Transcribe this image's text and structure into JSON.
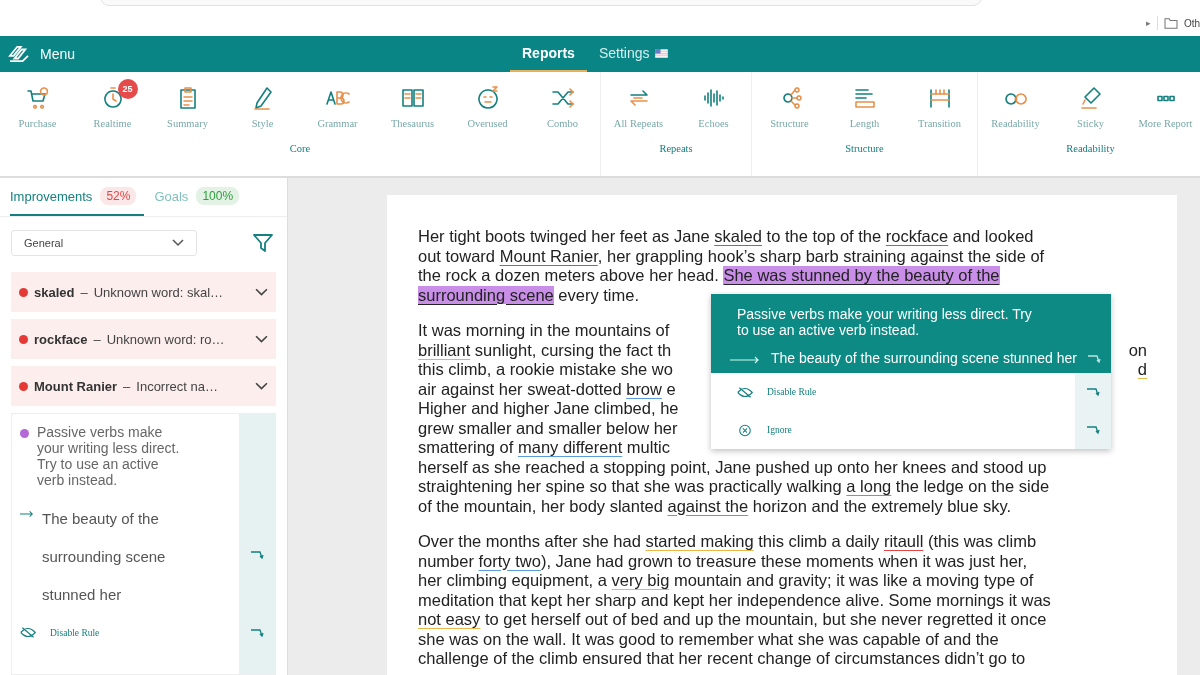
{
  "browser": {
    "arrow": "▸",
    "bookmark": "Oth"
  },
  "header": {
    "menu": "Menu",
    "nav": [
      {
        "label": "Reports",
        "selected": true,
        "flag": false
      },
      {
        "label": "Settings",
        "selected": false,
        "flag": true
      }
    ]
  },
  "ribbon": [
    {
      "label": "Core",
      "items": [
        {
          "label": "Purchase"
        },
        {
          "label": "Realtime",
          "badge": "25"
        },
        {
          "label": "Summary"
        },
        {
          "label": "Style"
        },
        {
          "label": "Grammar"
        },
        {
          "label": "Thesaurus"
        },
        {
          "label": "Overused"
        },
        {
          "label": "Combo"
        }
      ]
    },
    {
      "label": "Repeats",
      "items": [
        {
          "label": "All Repeats"
        },
        {
          "label": "Echoes"
        }
      ]
    },
    {
      "label": "Structure",
      "items": [
        {
          "label": "Structure"
        },
        {
          "label": "Length"
        },
        {
          "label": "Transition"
        }
      ]
    },
    {
      "label": "Readability",
      "items": [
        {
          "label": "Readability"
        },
        {
          "label": "Sticky"
        },
        {
          "label": "More Report"
        }
      ]
    }
  ],
  "sidebar": {
    "tabs": [
      {
        "label": "Improvements",
        "count": "52%",
        "color": "#e04848",
        "selected": true
      },
      {
        "label": "Goals",
        "count": "100%",
        "color": "#2e9e3e",
        "selected": false
      }
    ],
    "dropdown": "General",
    "issues": [
      {
        "kind": "collapsed",
        "word": "skaled",
        "dash": "–",
        "message": "Unknown word: skal…",
        "color": "#e53935"
      },
      {
        "kind": "collapsed",
        "word": "rockface",
        "dash": "–",
        "message": "Unknown word: ro…",
        "color": "#e53935"
      },
      {
        "kind": "collapsed",
        "word": "Mount Ranier",
        "dash": "–",
        "message": "Incorrect na…",
        "color": "#e53935"
      },
      {
        "kind": "expanded",
        "message": "Passive verbs make your writing less direct. Try to use an active verb instead.",
        "suggestion": "The beauty of the surrounding scene stunned her",
        "action": "Disable Rule",
        "color": "#b36ad6"
      }
    ]
  },
  "document": {
    "paragraphs": [
      {
        "lines": [
          {
            "segments": [
              {
                "text": "Her tight boots twinged her feet as Jane "
              },
              {
                "text": "skaled",
                "kind": "spelling"
              },
              {
                "text": " to the top of the "
              },
              {
                "text": "rockface",
                "kind": "spelling"
              },
              {
                "text": " and looked"
              }
            ]
          },
          {
            "segments": [
              {
                "text": "out toward "
              },
              {
                "text": "Mount Ranier",
                "kind": "spelling"
              },
              {
                "text": ", her grappling hook’s sharp barb straining against the side of"
              }
            ]
          },
          {
            "segments": [
              {
                "text": "the rock a dozen meters above her head. "
              },
              {
                "text": "She was stunned by the beauty of the",
                "kind": "passive"
              }
            ]
          },
          {
            "segments": [
              {
                "text": "surrounding scene",
                "kind": "passive"
              },
              {
                "text": " every time."
              }
            ]
          }
        ]
      },
      {
        "lines": [
          {
            "segments": [
              {
                "text": "It was morning in the mountains of"
              }
            ]
          },
          {
            "segments": [
              {
                "text": "brilliant",
                "kind": "style"
              },
              {
                "text": " sunlight, cursing the fact th"
              }
            ],
            "right": [
              {
                "text": "on"
              }
            ]
          },
          {
            "segments": [
              {
                "text": "this climb, a rookie mistake she wo"
              }
            ],
            "right": [
              {
                "text": "d",
                "kind": "style"
              }
            ]
          },
          {
            "segments": [
              {
                "text": "air against her sweat-dotted "
              },
              {
                "text": "brow",
                "kind": "clarity"
              },
              {
                "text": " e"
              }
            ]
          },
          {
            "segments": [
              {
                "text": "Higher and higher Jane climbed, he"
              }
            ]
          },
          {
            "segments": [
              {
                "text": "grew smaller and smaller below her"
              }
            ]
          },
          {
            "segments": [
              {
                "text": "smattering of "
              },
              {
                "text": "many different",
                "kind": "clarity"
              },
              {
                "text": " multic"
              }
            ]
          },
          {
            "segments": [
              {
                "text": "herself as she reached a stopping point, Jane pushed up onto her knees and stood up"
              }
            ]
          },
          {
            "segments": [
              {
                "text": "straightening her spine so that she was practically walking "
              },
              {
                "text": "a long",
                "kind": "clarity"
              },
              {
                "text": " the ledge on the side"
              }
            ]
          },
          {
            "segments": [
              {
                "text": "of the mountain, her body slanted "
              },
              {
                "text": "against  the",
                "kind": "clarity"
              },
              {
                "text": " horizon and the extremely blue sky."
              }
            ]
          }
        ]
      },
      {
        "lines": [
          {
            "segments": [
              {
                "text": "Over the months after she had "
              },
              {
                "text": "started making",
                "kind": "style"
              },
              {
                "text": " this climb a daily "
              },
              {
                "text": "ritaull",
                "kind": "spelling"
              },
              {
                "text": " (this was climb"
              }
            ]
          },
          {
            "segments": [
              {
                "text": "number "
              },
              {
                "text": "forty two",
                "kind": "clarity"
              },
              {
                "text": "), Jane had grown to treasure these moments when it was just her,"
              }
            ]
          },
          {
            "segments": [
              {
                "text": "her climbing equipment, a "
              },
              {
                "text": "very big",
                "kind": "style"
              },
              {
                "text": " mountain and gravity; it was like a moving type of"
              }
            ]
          },
          {
            "segments": [
              {
                "text": "meditation that kept her sharp and kept her independence alive. Some mornings it was"
              }
            ]
          },
          {
            "segments": [
              {
                "text": "not easy",
                "kind": "style"
              },
              {
                "text": " to get herself out of bed and up the mountain, but she never regretted it once"
              }
            ]
          },
          {
            "segments": [
              {
                "text": "she was on the wall. It was good to remember what she was capable of and the"
              }
            ]
          },
          {
            "segments": [
              {
                "text": "challenge of the climb ensured that her recent change of circumstances didn’t go to"
              }
            ]
          }
        ]
      }
    ]
  },
  "popup": {
    "message": "Passive verbs make your writing less direct. Try to use an active verb instead.",
    "suggestion": "The beauty of the surrounding scene stunned her",
    "actions": [
      {
        "kind": "disable",
        "label": "Disable Rule"
      },
      {
        "kind": "ignore",
        "label": "Ignore"
      }
    ]
  }
}
